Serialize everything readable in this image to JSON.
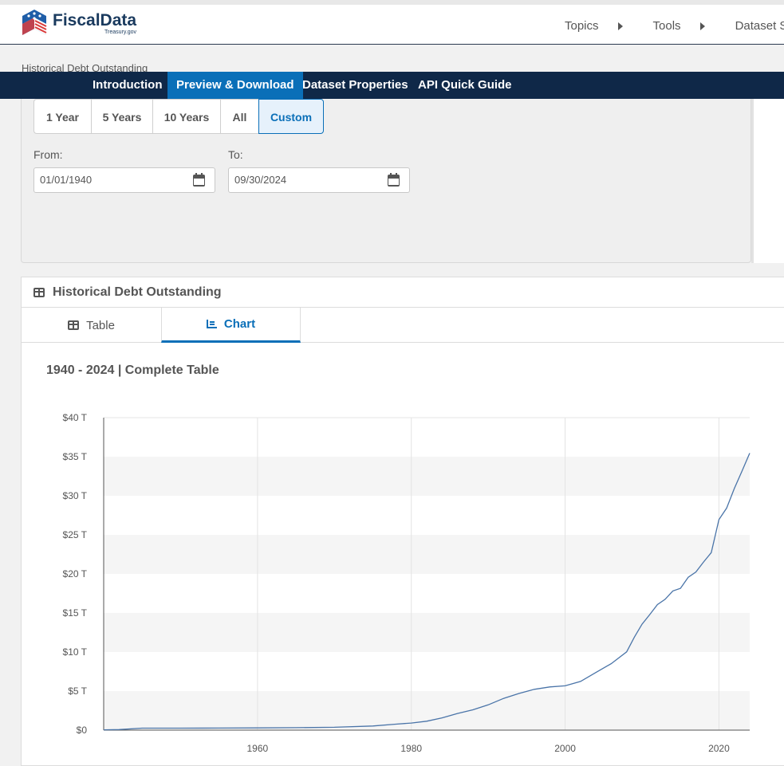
{
  "header": {
    "logo_title": "FiscalData",
    "logo_sub": "Treasury.gov",
    "nav": [
      "Topics",
      "Tools",
      "Dataset Se"
    ]
  },
  "breadcrumb": "Historical Debt Outstanding",
  "dataset_nav": {
    "tabs": [
      "Introduction",
      "Preview & Download",
      "Dataset Properties",
      "API Quick Guide"
    ],
    "active": "Preview & Download"
  },
  "range_buttons": {
    "items": [
      "1 Year",
      "5 Years",
      "10 Years",
      "All",
      "Custom"
    ],
    "active": "Custom"
  },
  "date_range": {
    "from_label": "From:",
    "from_value": "01/01/1940",
    "to_label": "To:",
    "to_value": "09/30/2024"
  },
  "card": {
    "title": "Historical Debt Outstanding",
    "view_tabs": [
      "Table",
      "Chart"
    ],
    "active_view": "Chart",
    "subtitle": "1940 - 2024 | Complete Table"
  },
  "colors": {
    "accent": "#0a6fb8",
    "nav_bg": "#0f2848",
    "line": "#4a74a8"
  },
  "chart_data": {
    "type": "line",
    "title": "",
    "xlabel": "",
    "ylabel": "",
    "xlim": [
      1940,
      2024
    ],
    "ylim": [
      0,
      40
    ],
    "x_ticks": [
      1960,
      1980,
      2000,
      2020
    ],
    "x_tick_labels": [
      "1960",
      "1980",
      "2000",
      "2020"
    ],
    "y_ticks": [
      0,
      5,
      10,
      15,
      20,
      25,
      30,
      35,
      40
    ],
    "y_tick_labels": [
      "$0",
      "$5 T",
      "$10 T",
      "$15 T",
      "$20 T",
      "$25 T",
      "$30 T",
      "$35 T",
      "$40 T"
    ],
    "grid": "vertical lines, alternating horizontal bands",
    "series": [
      {
        "x": [
          1940,
          1942,
          1945,
          1950,
          1955,
          1960,
          1965,
          1970,
          1975,
          1978,
          1980,
          1982,
          1984,
          1986,
          1988,
          1990,
          1992,
          1994,
          1996,
          1998,
          2000,
          2002,
          2004,
          2006,
          2008,
          2009,
          2010,
          2011,
          2012,
          2013,
          2014,
          2015,
          2016,
          2017,
          2018,
          2019,
          2020,
          2021,
          2022,
          2023,
          2024
        ],
        "y": [
          0.04,
          0.07,
          0.26,
          0.26,
          0.27,
          0.29,
          0.32,
          0.37,
          0.53,
          0.77,
          0.91,
          1.14,
          1.57,
          2.13,
          2.6,
          3.23,
          4.06,
          4.69,
          5.22,
          5.53,
          5.67,
          6.23,
          7.38,
          8.51,
          10.02,
          11.91,
          13.56,
          14.79,
          16.07,
          16.74,
          17.82,
          18.15,
          19.57,
          20.24,
          21.52,
          22.72,
          26.95,
          28.43,
          30.93,
          33.17,
          35.46
        ]
      }
    ]
  }
}
